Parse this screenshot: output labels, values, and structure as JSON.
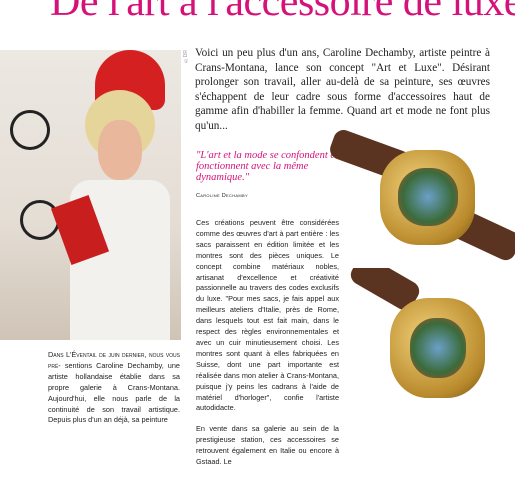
{
  "article": {
    "title": "De l'art à l'accessoire de luxe",
    "photo_credit": "©DR",
    "intro": "Voici un peu plus d'un ans, Caroline Dechamby, artiste peintre à Crans-Montana, lance son concept \"Art et Luxe\". Désirant prolonger son travail, aller au-delà de sa peinture, ses œuvres s'échappent de leur cadre sous forme d'accessoires haut de gamme afin d'habiller la femme. Quand art et mode ne font plus qu'un...",
    "quote": "\"L'art et la mode se confondent et fonctionnent avec la même dynamique.\"",
    "quote_author": "Caroline Dechamby",
    "body_p1": "Ces créations peuvent être considérées comme des œuvres d'art à part entière : les sacs paraissent en édition limitée et les montres sont des pièces uniques. Le concept combine matériaux nobles, artisanat d'excellence et créativité passionnelle au travers des codes exclusifs du luxe. \"Pour mes sacs, je fais appel aux meilleurs ateliers d'Italie, près de Rome, dans lesquels tout est fait main, dans le respect des règles environnementales et avec un cuir minutieusement choisi. Les montres sont quant à elles fabriquées en Suisse, dont une part importante est réalisée dans mon atelier à Crans-Montana, puisque j'y peins les cadrans à l'aide de matériel d'horloger\", confie l'artiste autodidacte.",
    "body_p2": "En vente dans sa galerie au sein de la prestigieuse station, ces accessoires se retrouvent également en Italie ou encore à Gstaad. Le",
    "caption_lead": "Dans L'Éventail de juin dernier, nous vous pré-",
    "caption": "sentions Caroline Dechamby, une artiste hollandaise établie dans sa propre galerie à Crans-Montana. Aujourd'hui, elle nous parle de la continuité de son travail artistique. Depuis plus d'un an déjà, sa peinture"
  },
  "colors": {
    "accent": "#d4127a",
    "text": "#222222"
  }
}
